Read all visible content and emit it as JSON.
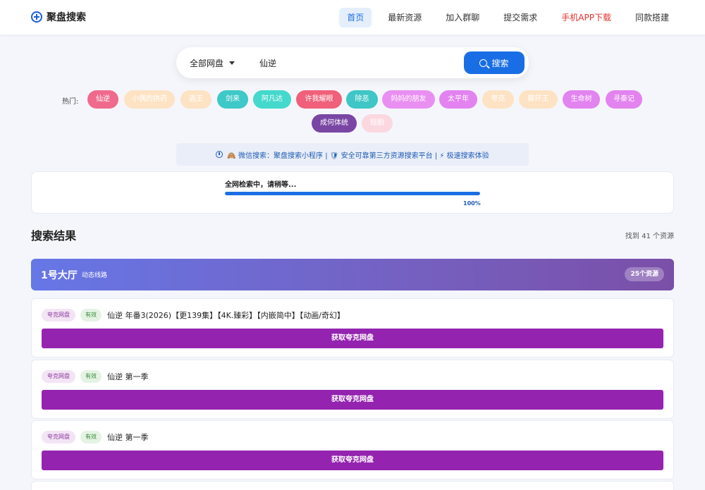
{
  "header": {
    "logo_text": "聚盘搜索",
    "nav": [
      {
        "label": "首页",
        "active": true
      },
      {
        "label": "最新资源"
      },
      {
        "label": "加入群聊"
      },
      {
        "label": "提交需求"
      },
      {
        "label": "手机APP下载",
        "highlight": "#e5322d"
      },
      {
        "label": "同款搭建"
      }
    ]
  },
  "search": {
    "select_label": "全部网盘",
    "query": "仙逆",
    "button_label": "搜索"
  },
  "hot": {
    "label": "热门:",
    "tags": [
      {
        "label": "仙逆",
        "color": "#f06a8e"
      },
      {
        "label": "小偶的拱药",
        "color": "#fde3c4"
      },
      {
        "label": "逃王",
        "color": "#fde3c4"
      },
      {
        "label": "剑来",
        "color": "#3ec8c8"
      },
      {
        "label": "阿凡达",
        "color": "#45d8cc"
      },
      {
        "label": "许我耀眼",
        "color": "#f0607a"
      },
      {
        "label": "除恶",
        "color": "#3fc6c6"
      },
      {
        "label": "妈妈的朋友",
        "color": "#e98ff2"
      },
      {
        "label": "太平年",
        "color": "#e383f0"
      },
      {
        "label": "夸克",
        "color": "#fde3c4"
      },
      {
        "label": "藤环王",
        "color": "#fde3c4"
      },
      {
        "label": "生命树",
        "color": "#e383f0"
      },
      {
        "label": "寻秦记",
        "color": "#e383f0"
      },
      {
        "label": "成何体统",
        "color": "#7a46a4"
      },
      {
        "label": "短剧",
        "color": "#fbd8e0"
      }
    ]
  },
  "notice": {
    "text": "🙈 微信搜索：聚盘搜索小程序 | 🛡 安全可靠第三方资源搜索平台 | ⚡ 极速搜索体验"
  },
  "progress": {
    "text": "全网检索中，请稍等...",
    "percent_label": "100%",
    "value": 1.0
  },
  "results": {
    "title": "搜索结果",
    "count": "找到 41 个资源",
    "hall": {
      "name": "1号大厅",
      "sub": "动态线路",
      "badge": "25个资源"
    },
    "items": [
      {
        "source": "夸克网盘",
        "status": "有效",
        "title": "仙逆 年番3(2026)【更139集】【4K.臻彩】【内嵌简中】【动画/奇幻】",
        "button": "获取夸克网盘"
      },
      {
        "source": "夸克网盘",
        "status": "有效",
        "title": "仙逆 第一季",
        "button": "获取夸克网盘"
      },
      {
        "source": "夸克网盘",
        "status": "有效",
        "title": "仙逆 第一季",
        "button": "获取夸克网盘"
      }
    ]
  }
}
